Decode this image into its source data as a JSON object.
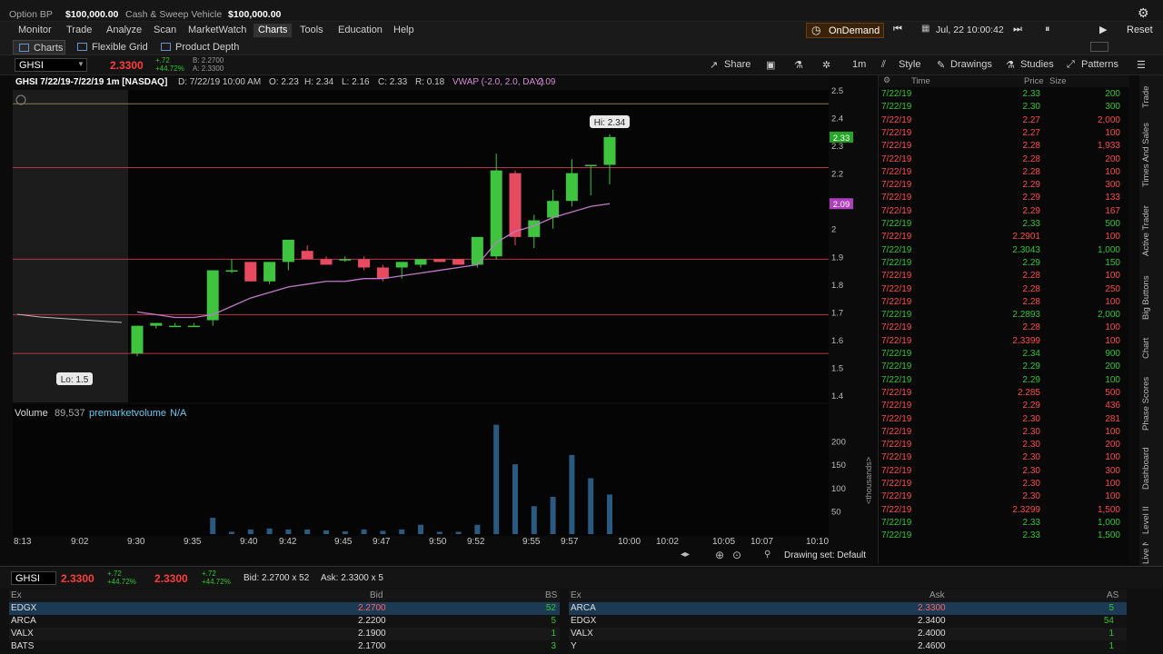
{
  "topbar": {
    "option_bp_label": "Option BP",
    "option_bp_value": "$100,000.00",
    "cash_label": "Cash & Sweep Vehicle",
    "cash_value": "$100,000.00"
  },
  "menu": [
    "Monitor",
    "Trade",
    "Analyze",
    "Scan",
    "MarketWatch",
    "Charts",
    "Tools",
    "Education",
    "Help"
  ],
  "menu_active": "Charts",
  "ondemand": {
    "label": "OnDemand",
    "datetime": "Jul, 22 10:00:42",
    "reset": "Reset"
  },
  "subtabs": {
    "charts": "Charts",
    "flexible_grid": "Flexible Grid",
    "product_depth": "Product Depth"
  },
  "toolbar": {
    "symbol": "GHSI",
    "price": "2.3300",
    "change_abs": "+.72",
    "change_pct": "+44.72%",
    "bid_mini": "B: 2.2700",
    "ask_mini": "A: 2.3300",
    "share": "Share",
    "timeframe": "1m",
    "style": "Style",
    "drawings": "Drawings",
    "studies": "Studies",
    "patterns": "Patterns"
  },
  "chart_header": {
    "title": "GHSI 7/22/19-7/22/19 1m [NASDAQ]",
    "date": "D: 7/22/19 10:00 AM",
    "open": "O: 2.23",
    "high": "H: 2.34",
    "low": "L: 2.16",
    "close": "C: 2.33",
    "range": "R: 0.18",
    "vwap": "VWAP (-2.0, 2.0, DAY)",
    "vwap_value": "2.09"
  },
  "annotations": {
    "hi": "Hi: 2.34",
    "lo": "Lo: 1.5",
    "last_price_tag": "2.33",
    "vwap_tag": "2.09"
  },
  "price_axis": [
    "2.5",
    "2.4",
    "2.3",
    "2.2",
    "2.1",
    "2",
    "1.9",
    "1.8",
    "1.7",
    "1.6",
    "1.5",
    "1.4"
  ],
  "volume_header": {
    "label": "Volume",
    "value": "89,537",
    "study": "premarketvolume",
    "study_value": "N/A",
    "unit": "<thousands>"
  },
  "volume_axis": [
    "200",
    "150",
    "100",
    "50"
  ],
  "time_axis": [
    "8:13",
    "9:02",
    "9:30",
    "9:35",
    "9:40",
    "9:42",
    "9:45",
    "9:47",
    "9:50",
    "9:52",
    "9:55",
    "9:57",
    "10:00",
    "10:02",
    "10:05",
    "10:07",
    "10:10"
  ],
  "drawing_set": "Drawing set: Default",
  "chart_data": {
    "type": "candlestick",
    "interval": "1m",
    "price_range": [
      1.4,
      2.5
    ],
    "volume_unit": "thousands",
    "horizontal_levels": [
      2.45,
      2.22,
      1.89,
      1.69,
      1.55
    ],
    "candles": [
      {
        "o": 1.55,
        "h": 1.65,
        "l": 1.54,
        "c": 1.65,
        "v": 0
      },
      {
        "o": 1.65,
        "h": 1.66,
        "l": 1.64,
        "c": 1.66,
        "v": 0
      },
      {
        "o": 1.65,
        "h": 1.66,
        "l": 1.65,
        "c": 1.65,
        "v": 0
      },
      {
        "o": 1.65,
        "h": 1.66,
        "l": 1.65,
        "c": 1.65,
        "v": 0
      },
      {
        "o": 1.67,
        "h": 1.85,
        "l": 1.65,
        "c": 1.85,
        "v": 35
      },
      {
        "o": 1.85,
        "h": 1.89,
        "l": 1.84,
        "c": 1.85,
        "v": 5
      },
      {
        "o": 1.88,
        "h": 1.88,
        "l": 1.81,
        "c": 1.81,
        "v": 10
      },
      {
        "o": 1.81,
        "h": 1.88,
        "l": 1.8,
        "c": 1.88,
        "v": 12
      },
      {
        "o": 1.88,
        "h": 1.96,
        "l": 1.85,
        "c": 1.96,
        "v": 10
      },
      {
        "o": 1.92,
        "h": 1.94,
        "l": 1.89,
        "c": 1.89,
        "v": 10
      },
      {
        "o": 1.89,
        "h": 1.9,
        "l": 1.87,
        "c": 1.87,
        "v": 8
      },
      {
        "o": 1.89,
        "h": 1.9,
        "l": 1.88,
        "c": 1.89,
        "v": 6
      },
      {
        "o": 1.89,
        "h": 1.9,
        "l": 1.85,
        "c": 1.86,
        "v": 10
      },
      {
        "o": 1.86,
        "h": 1.87,
        "l": 1.81,
        "c": 1.82,
        "v": 7
      },
      {
        "o": 1.86,
        "h": 1.88,
        "l": 1.82,
        "c": 1.88,
        "v": 10
      },
      {
        "o": 1.87,
        "h": 1.89,
        "l": 1.86,
        "c": 1.89,
        "v": 20
      },
      {
        "o": 1.89,
        "h": 1.89,
        "l": 1.88,
        "c": 1.88,
        "v": 5
      },
      {
        "o": 1.89,
        "h": 1.89,
        "l": 1.87,
        "c": 1.87,
        "v": 5
      },
      {
        "o": 1.87,
        "h": 1.97,
        "l": 1.86,
        "c": 1.97,
        "v": 20
      },
      {
        "o": 1.9,
        "h": 2.27,
        "l": 1.89,
        "c": 2.21,
        "v": 235
      },
      {
        "o": 2.2,
        "h": 2.21,
        "l": 1.94,
        "c": 1.97,
        "v": 150
      },
      {
        "o": 1.97,
        "h": 2.05,
        "l": 1.93,
        "c": 2.03,
        "v": 60
      },
      {
        "o": 2.04,
        "h": 2.14,
        "l": 2.0,
        "c": 2.1,
        "v": 80
      },
      {
        "o": 2.1,
        "h": 2.25,
        "l": 2.08,
        "c": 2.2,
        "v": 170
      },
      {
        "o": 2.23,
        "h": 2.23,
        "l": 2.12,
        "c": 2.23,
        "v": 120
      },
      {
        "o": 2.23,
        "h": 2.34,
        "l": 2.16,
        "c": 2.33,
        "v": 85
      }
    ],
    "vwap": [
      1.7,
      1.69,
      1.68,
      1.68,
      1.69,
      1.72,
      1.75,
      1.77,
      1.79,
      1.8,
      1.81,
      1.81,
      1.82,
      1.82,
      1.83,
      1.84,
      1.85,
      1.86,
      1.87,
      1.95,
      1.99,
      2.01,
      2.04,
      2.06,
      2.08,
      2.09
    ]
  },
  "times_sales": {
    "headers": {
      "time": "Time",
      "price": "Price",
      "size": "Size"
    },
    "rows": [
      {
        "t": "7/22/19",
        "p": "2.33",
        "s": "200",
        "up": true
      },
      {
        "t": "7/22/19",
        "p": "2.30",
        "s": "300",
        "up": true
      },
      {
        "t": "7/22/19",
        "p": "2.27",
        "s": "2,000",
        "up": false
      },
      {
        "t": "7/22/19",
        "p": "2.27",
        "s": "100",
        "up": false
      },
      {
        "t": "7/22/19",
        "p": "2.28",
        "s": "1,933",
        "up": false
      },
      {
        "t": "7/22/19",
        "p": "2.28",
        "s": "200",
        "up": false
      },
      {
        "t": "7/22/19",
        "p": "2.28",
        "s": "100",
        "up": false
      },
      {
        "t": "7/22/19",
        "p": "2.29",
        "s": "300",
        "up": false
      },
      {
        "t": "7/22/19",
        "p": "2.29",
        "s": "133",
        "up": false
      },
      {
        "t": "7/22/19",
        "p": "2.29",
        "s": "167",
        "up": false
      },
      {
        "t": "7/22/19",
        "p": "2.33",
        "s": "500",
        "up": true
      },
      {
        "t": "7/22/19",
        "p": "2.2901",
        "s": "100",
        "up": false
      },
      {
        "t": "7/22/19",
        "p": "2.3043",
        "s": "1,000",
        "up": true
      },
      {
        "t": "7/22/19",
        "p": "2.29",
        "s": "150",
        "up": true
      },
      {
        "t": "7/22/19",
        "p": "2.28",
        "s": "100",
        "up": false
      },
      {
        "t": "7/22/19",
        "p": "2.28",
        "s": "250",
        "up": false
      },
      {
        "t": "7/22/19",
        "p": "2.28",
        "s": "100",
        "up": false
      },
      {
        "t": "7/22/19",
        "p": "2.2893",
        "s": "2,000",
        "up": true
      },
      {
        "t": "7/22/19",
        "p": "2.28",
        "s": "100",
        "up": false
      },
      {
        "t": "7/22/19",
        "p": "2.3399",
        "s": "100",
        "up": false
      },
      {
        "t": "7/22/19",
        "p": "2.34",
        "s": "900",
        "up": true
      },
      {
        "t": "7/22/19",
        "p": "2.29",
        "s": "200",
        "up": true
      },
      {
        "t": "7/22/19",
        "p": "2.29",
        "s": "100",
        "up": true
      },
      {
        "t": "7/22/19",
        "p": "2.285",
        "s": "500",
        "up": false
      },
      {
        "t": "7/22/19",
        "p": "2.29",
        "s": "436",
        "up": false
      },
      {
        "t": "7/22/19",
        "p": "2.30",
        "s": "281",
        "up": false
      },
      {
        "t": "7/22/19",
        "p": "2.30",
        "s": "100",
        "up": false
      },
      {
        "t": "7/22/19",
        "p": "2.30",
        "s": "200",
        "up": false
      },
      {
        "t": "7/22/19",
        "p": "2.30",
        "s": "100",
        "up": false
      },
      {
        "t": "7/22/19",
        "p": "2.30",
        "s": "300",
        "up": false
      },
      {
        "t": "7/22/19",
        "p": "2.30",
        "s": "100",
        "up": false
      },
      {
        "t": "7/22/19",
        "p": "2.30",
        "s": "100",
        "up": false
      },
      {
        "t": "7/22/19",
        "p": "2.3299",
        "s": "1,500",
        "up": false
      },
      {
        "t": "7/22/19",
        "p": "2.33",
        "s": "1,000",
        "up": true
      },
      {
        "t": "7/22/19",
        "p": "2.33",
        "s": "1,500",
        "up": true
      }
    ]
  },
  "right_rail": [
    "Trade",
    "Times And Sales",
    "Active Trader",
    "Big Buttons",
    "Chart",
    "Phase Scores",
    "Dashboard",
    "Level II",
    "Live News"
  ],
  "level2": {
    "symbol": "GHSI",
    "price": "2.3300",
    "change_abs": "+.72",
    "change_pct": "+44.72%",
    "price2": "2.3300",
    "bid": "Bid: 2.2700 x 52",
    "ask": "Ask: 2.3300 x 5",
    "bid_headers": {
      "ex": "Ex",
      "price": "Bid",
      "size": "BS"
    },
    "ask_headers": {
      "ex": "Ex",
      "price": "Ask",
      "size": "AS"
    },
    "bids": [
      {
        "ex": "EDGX",
        "price": "2.2700",
        "size": "52"
      },
      {
        "ex": "ARCA",
        "price": "2.2200",
        "size": "5"
      },
      {
        "ex": "VALX",
        "price": "2.1900",
        "size": "1"
      },
      {
        "ex": "BATS",
        "price": "2.1700",
        "size": "3"
      }
    ],
    "asks": [
      {
        "ex": "ARCA",
        "price": "2.3300",
        "size": "5"
      },
      {
        "ex": "EDGX",
        "price": "2.3400",
        "size": "54"
      },
      {
        "ex": "VALX",
        "price": "2.4000",
        "size": "1"
      },
      {
        "ex": "Y",
        "price": "2.4600",
        "size": "1"
      }
    ]
  },
  "colors": {
    "up": "#2fc62f",
    "down": "#ff4a4a",
    "vwap": "#c07ac8",
    "level": "#b8324a",
    "volume": "#2a5a80"
  }
}
